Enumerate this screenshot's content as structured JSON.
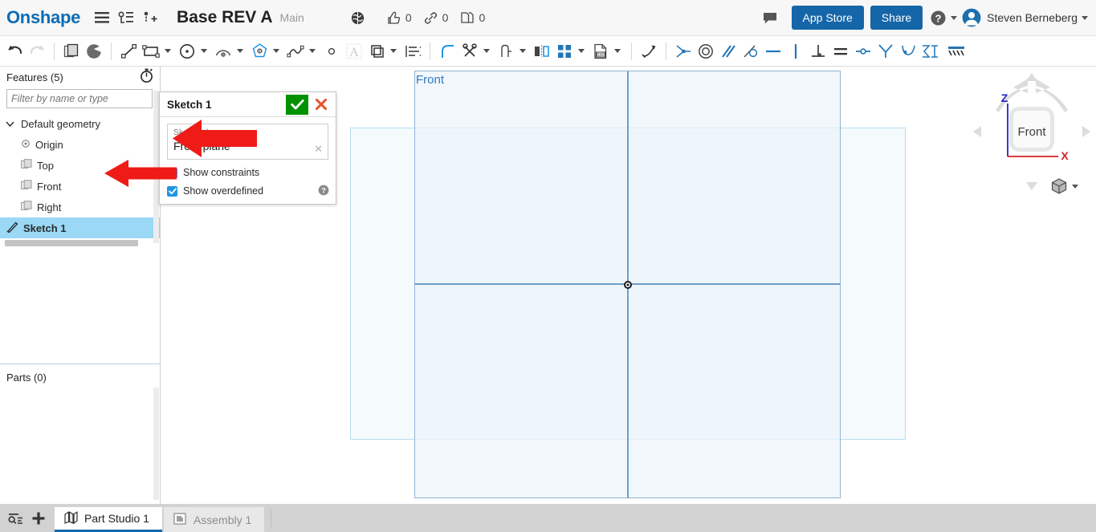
{
  "header": {
    "brand": "Onshape",
    "menu_icon": "hamburger-icon",
    "versions_icon": "version-graph-icon",
    "add_version_icon": "add-version-icon",
    "document_title": "Base REV A",
    "branch": "Main",
    "globe_icon": "globe-icon",
    "counters": [
      {
        "icon": "thumbs-up-icon",
        "name": "like-counter",
        "value": "0"
      },
      {
        "icon": "link-icon",
        "name": "link-counter",
        "value": "0"
      },
      {
        "icon": "copy-icon",
        "name": "copy-counter",
        "value": "0"
      }
    ],
    "comment_icon": "comment-icon",
    "app_store_label": "App Store",
    "share_label": "Share",
    "help_icon": "question-mark-icon",
    "user_name": "Steven Berneberg",
    "avatar_icon": "user-avatar-icon"
  },
  "toolbar": {
    "items": [
      {
        "name": "undo-button",
        "icon": "undo-arrow-icon",
        "caret": false,
        "disabled": false
      },
      {
        "name": "redo-button",
        "icon": "redo-arrow-icon",
        "caret": false,
        "disabled": true
      },
      {
        "name": "divider-1",
        "icon": "divider",
        "caret": false,
        "disabled": false
      },
      {
        "name": "new-sketch-button",
        "icon": "sketch-planes-icon",
        "caret": false,
        "disabled": false
      },
      {
        "name": "sketch-shade-button",
        "icon": "pac-shade-icon",
        "caret": false,
        "disabled": false
      },
      {
        "name": "divider-2",
        "icon": "divider",
        "caret": false,
        "disabled": false
      },
      {
        "name": "line-tool",
        "icon": "line-icon",
        "caret": false,
        "disabled": false
      },
      {
        "name": "rectangle-tool",
        "icon": "rectangle-icon",
        "caret": true,
        "disabled": false
      },
      {
        "name": "circle-tool",
        "icon": "circle-icon",
        "caret": true,
        "disabled": false
      },
      {
        "name": "arc-tool",
        "icon": "arc-icon",
        "caret": true,
        "disabled": false
      },
      {
        "name": "polygon-tool",
        "icon": "polygon-icon",
        "caret": true,
        "disabled": false
      },
      {
        "name": "spline-tool",
        "icon": "spline-icon",
        "caret": true,
        "disabled": false
      },
      {
        "name": "point-tool",
        "icon": "point-icon",
        "caret": false,
        "disabled": false
      },
      {
        "name": "text-tool",
        "icon": "text-a-icon",
        "caret": false,
        "disabled": true
      },
      {
        "name": "offset-tool",
        "icon": "offset-icon",
        "caret": true,
        "disabled": false
      },
      {
        "name": "dimension-stack-tool",
        "icon": "dimension-stack-icon",
        "caret": false,
        "disabled": false
      },
      {
        "name": "divider-3",
        "icon": "divider",
        "caret": false,
        "disabled": false
      },
      {
        "name": "fillet-tool",
        "icon": "fillet-arc-icon",
        "caret": false,
        "disabled": false
      },
      {
        "name": "trim-tool",
        "icon": "scissors-icon",
        "caret": true,
        "disabled": false
      },
      {
        "name": "extend-tool",
        "icon": "extend-icon",
        "caret": true,
        "disabled": false
      },
      {
        "name": "mirror-tool",
        "icon": "mirror-icon",
        "caret": false,
        "disabled": false
      },
      {
        "name": "pattern-tool",
        "icon": "pattern-grid-icon",
        "caret": true,
        "disabled": false
      },
      {
        "name": "import-dxf-tool",
        "icon": "dxf-file-icon",
        "caret": true,
        "disabled": false
      },
      {
        "name": "divider-4",
        "icon": "divider",
        "caret": false,
        "disabled": false
      },
      {
        "name": "transform-tool",
        "icon": "move-arrow-icon",
        "caret": false,
        "disabled": false
      },
      {
        "name": "divider-5",
        "icon": "divider",
        "caret": false,
        "disabled": false
      },
      {
        "name": "coincident-constraint",
        "icon": "coincident-icon",
        "caret": false,
        "disabled": false
      },
      {
        "name": "concentric-constraint",
        "icon": "concentric-icon",
        "caret": false,
        "disabled": false
      },
      {
        "name": "parallel-constraint",
        "icon": "parallel-icon",
        "caret": false,
        "disabled": false
      },
      {
        "name": "tangent-constraint",
        "icon": "tangent-icon",
        "caret": false,
        "disabled": false
      },
      {
        "name": "horizontal-constraint",
        "icon": "horizontal-icon",
        "caret": false,
        "disabled": false
      },
      {
        "name": "vertical-constraint",
        "icon": "vertical-icon",
        "caret": false,
        "disabled": false
      },
      {
        "name": "perpendicular-constraint",
        "icon": "perpendicular-icon",
        "caret": false,
        "disabled": false
      },
      {
        "name": "equal-constraint",
        "icon": "equal-icon",
        "caret": false,
        "disabled": false
      },
      {
        "name": "midpoint-constraint",
        "icon": "midpoint-icon",
        "caret": false,
        "disabled": false
      },
      {
        "name": "symmetric-constraint",
        "icon": "symmetric-icon",
        "caret": false,
        "disabled": false
      },
      {
        "name": "curvature-constraint",
        "icon": "curvature-icon",
        "caret": false,
        "disabled": false
      },
      {
        "name": "normal-constraint",
        "icon": "normal-sigma-icon",
        "caret": false,
        "disabled": false
      },
      {
        "name": "construction-tool",
        "icon": "construction-hatch-icon",
        "caret": false,
        "disabled": false
      }
    ]
  },
  "features_panel": {
    "title": "Features (5)",
    "history_icon": "stopwatch-icon",
    "filter_placeholder": "Filter by name or type",
    "filter_value": "",
    "tree": [
      {
        "label": "Default geometry",
        "icon": "chevron-down-icon",
        "level": 0,
        "selected": false,
        "name": "tree-item-default-geometry"
      },
      {
        "label": "Origin",
        "icon": "origin-icon",
        "level": 1,
        "selected": false,
        "name": "tree-item-origin"
      },
      {
        "label": "Top",
        "icon": "plane-icon",
        "level": 1,
        "selected": false,
        "name": "tree-item-top"
      },
      {
        "label": "Front",
        "icon": "plane-icon",
        "level": 1,
        "selected": false,
        "name": "tree-item-front"
      },
      {
        "label": "Right",
        "icon": "plane-icon",
        "level": 1,
        "selected": false,
        "name": "tree-item-right"
      },
      {
        "label": "Sketch 1",
        "icon": "sketch-icon",
        "level": 0,
        "selected": true,
        "name": "tree-item-sketch-1"
      }
    ],
    "parts_title": "Parts (0)"
  },
  "sketch_dialog": {
    "title": "Sketch 1",
    "accept_icon": "checkmark-icon",
    "cancel_icon": "x-close-icon",
    "plane_field_label": "Sketch plane",
    "plane_field_value": "Front plane",
    "clear_icon": "clear-x-icon",
    "show_constraints_label": "Show constraints",
    "show_constraints_checked": true,
    "show_overdefined_label": "Show overdefined",
    "show_overdefined_checked": true,
    "help_icon": "help-circle-icon"
  },
  "canvas": {
    "plane_label": "Front",
    "origin_icon": "origin-point-icon",
    "annotations": [
      {
        "name": "red-arrow-sketch-plane",
        "points_to": "sketch-plane-field"
      },
      {
        "name": "red-arrow-show-constraints",
        "points_to": "show-constraints-checkbox"
      }
    ]
  },
  "view_cube": {
    "face_label": "Front",
    "axis_z_label": "Z",
    "axis_x_label": "X",
    "view_mode_icon": "shaded-cube-icon"
  },
  "bottom_bar": {
    "filter_icon": "tab-search-icon",
    "add_tab_icon": "plus-icon",
    "tabs": [
      {
        "label": "Part Studio 1",
        "icon": "part-studio-icon",
        "active": true,
        "name": "tab-part-studio-1"
      },
      {
        "label": "Assembly 1",
        "icon": "assembly-icon",
        "active": false,
        "name": "tab-assembly-1"
      }
    ]
  },
  "colors": {
    "brand_blue": "#0c6cb5",
    "button_blue": "#1566a8",
    "selection_blue": "#9ad8f5",
    "accept_green": "#009100",
    "cancel_red": "#e8502a",
    "annotation_red": "#ee1b17",
    "plane_blue": "#8fb4d4",
    "axis_red": "#d42121",
    "axis_blue": "#2222cc"
  }
}
